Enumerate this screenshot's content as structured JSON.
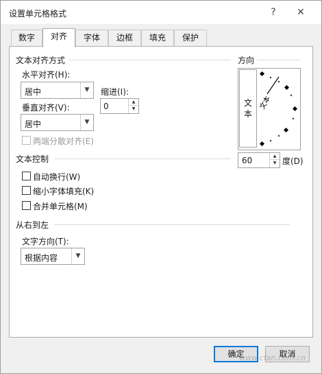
{
  "window": {
    "title": "设置单元格格式",
    "help_label": "?",
    "close_label": "✕"
  },
  "tabs": [
    {
      "label": "数字"
    },
    {
      "label": "对齐"
    },
    {
      "label": "字体"
    },
    {
      "label": "边框"
    },
    {
      "label": "填充"
    },
    {
      "label": "保护"
    }
  ],
  "active_tab": "对齐",
  "text_alignment": {
    "group_label": "文本对齐方式",
    "horizontal_label": "水平对齐(H):",
    "horizontal_value": "居中",
    "indent_label": "缩进(I):",
    "indent_value": "0",
    "vertical_label": "垂直对齐(V):",
    "vertical_value": "居中",
    "justify_distributed_label": "两端分散对齐(E)"
  },
  "text_control": {
    "group_label": "文本控制",
    "wrap_text_label": "自动换行(W)",
    "shrink_to_fit_label": "缩小字体填充(K)",
    "merge_cells_label": "合并单元格(M)"
  },
  "rtl": {
    "group_label": "从右到左",
    "direction_label": "文字方向(T):",
    "direction_value": "根据内容"
  },
  "orientation": {
    "group_label": "方向",
    "vertical_text_chars": [
      "文",
      "本"
    ],
    "dial_text": "文本",
    "degrees_value": "60",
    "degrees_label": "度(D)"
  },
  "footer": {
    "ok_label": "确定",
    "cancel_label": "取消",
    "watermark": "www.cfan.com.cn"
  },
  "colors": {
    "accent": "#0078d7",
    "dialog_bg": "#f0f0f0"
  }
}
